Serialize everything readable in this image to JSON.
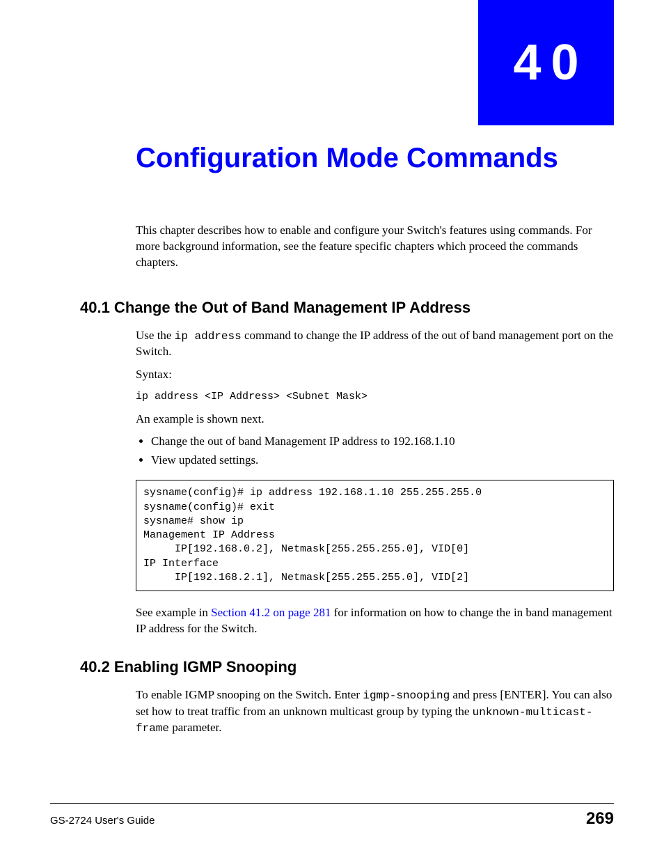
{
  "chapter": {
    "number": "40",
    "title": "Configuration Mode Commands"
  },
  "intro": "This chapter describes how to enable and configure your Switch's features using commands. For more background information, see the feature specific chapters which proceed the commands chapters.",
  "section1": {
    "heading": "40.1  Change the Out of Band Management IP Address",
    "p1_a": "Use the ",
    "p1_code": "ip address",
    "p1_b": " command to change the IP address of the out of band management port on the Switch.",
    "syntax_label": "Syntax:",
    "syntax_line": "ip address <IP Address> <Subnet Mask>",
    "p2": "An example is shown next.",
    "bullets": [
      "Change the out of band Management IP address to 192.168.1.10",
      "View updated settings."
    ],
    "code_block": "sysname(config)# ip address 192.168.1.10 255.255.255.0\nsysname(config)# exit\nsysname# show ip\nManagement IP Address\n     IP[192.168.0.2], Netmask[255.255.255.0], VID[0]\nIP Interface\n     IP[192.168.2.1], Netmask[255.255.255.0], VID[2]",
    "p3_a": "See example in ",
    "p3_link": "Section 41.2 on page 281",
    "p3_b": " for information on how to change the in band management IP address for the Switch."
  },
  "section2": {
    "heading": "40.2  Enabling IGMP Snooping",
    "p1_a": "To enable IGMP snooping on the Switch. Enter ",
    "p1_code1": "igmp-snooping",
    "p1_b": " and press [ENTER]. You can also set how to treat traffic from an unknown multicast group by typing the ",
    "p1_code2": "unknown-multicast-frame",
    "p1_c": " parameter."
  },
  "footer": {
    "guide": "GS-2724 User's Guide",
    "page": "269"
  }
}
